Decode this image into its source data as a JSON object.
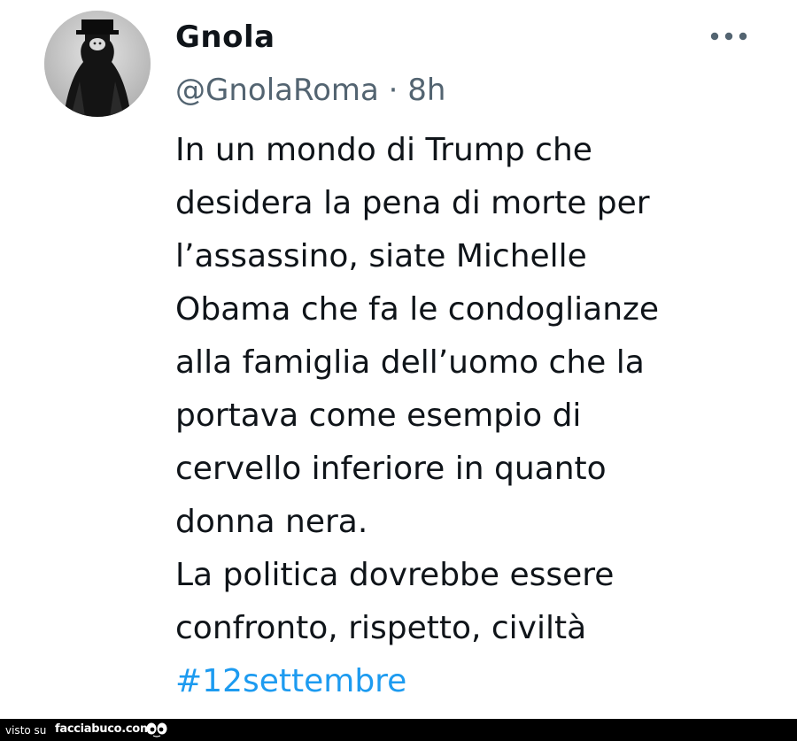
{
  "tweet": {
    "author": {
      "display_name": "Gnola",
      "handle": "@GnolaRoma",
      "separator": "·",
      "time": "8h",
      "avatar_icon": "avatar-hooded-figure"
    },
    "more_icon": "more-horizontal-icon",
    "text_lines": [
      "In un mondo di Trump che",
      "desidera la pena di morte per",
      "l’assassino, siate Michelle",
      "Obama che fa le condoglianze",
      "alla famiglia dell’uomo che la",
      "portava come esempio di",
      "cervello inferiore in quanto",
      "donna nera.",
      "La politica dovrebbe essere",
      "confronto, rispetto, civiltà"
    ],
    "hashtag": "#12settembre"
  },
  "footer": {
    "prefix": "visto su",
    "site": "facciabuco.com",
    "logo_icon": "eyes-icon"
  },
  "colors": {
    "text": "#0f1419",
    "secondary": "#536471",
    "hashtag": "#1d9bf0",
    "footer_bg": "#000000"
  }
}
